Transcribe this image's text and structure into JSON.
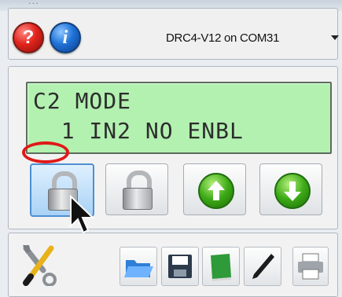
{
  "window": {
    "title_fragment": "..."
  },
  "toolbar": {
    "help_label": "?",
    "info_label": "i",
    "device_select": {
      "value": "DRC4-V12 on COM31"
    }
  },
  "lcd": {
    "line1": "C2 MODE",
    "line2": "  1 IN2 NO ENBL"
  },
  "buttons": [
    {
      "name": "lock-button-1",
      "icon": "padlock-icon",
      "state": "pressed"
    },
    {
      "name": "lock-button-2",
      "icon": "padlock-icon",
      "state": "normal"
    },
    {
      "name": "up-button",
      "icon": "up-arrow-icon",
      "state": "normal"
    },
    {
      "name": "down-button",
      "icon": "down-arrow-icon",
      "state": "normal"
    }
  ],
  "bottom_toolbar": {
    "icons": [
      "settings-icon",
      "open-folder-icon",
      "save-icon",
      "book-icon",
      "pen-icon",
      "printer-icon"
    ]
  },
  "annotation": {
    "highlight_color": "#e01818"
  },
  "colors": {
    "lcd_background": "#b3f1b0",
    "help_red": "#e2241c",
    "info_blue": "#1f73d8",
    "arrow_green": "#3caa16"
  }
}
